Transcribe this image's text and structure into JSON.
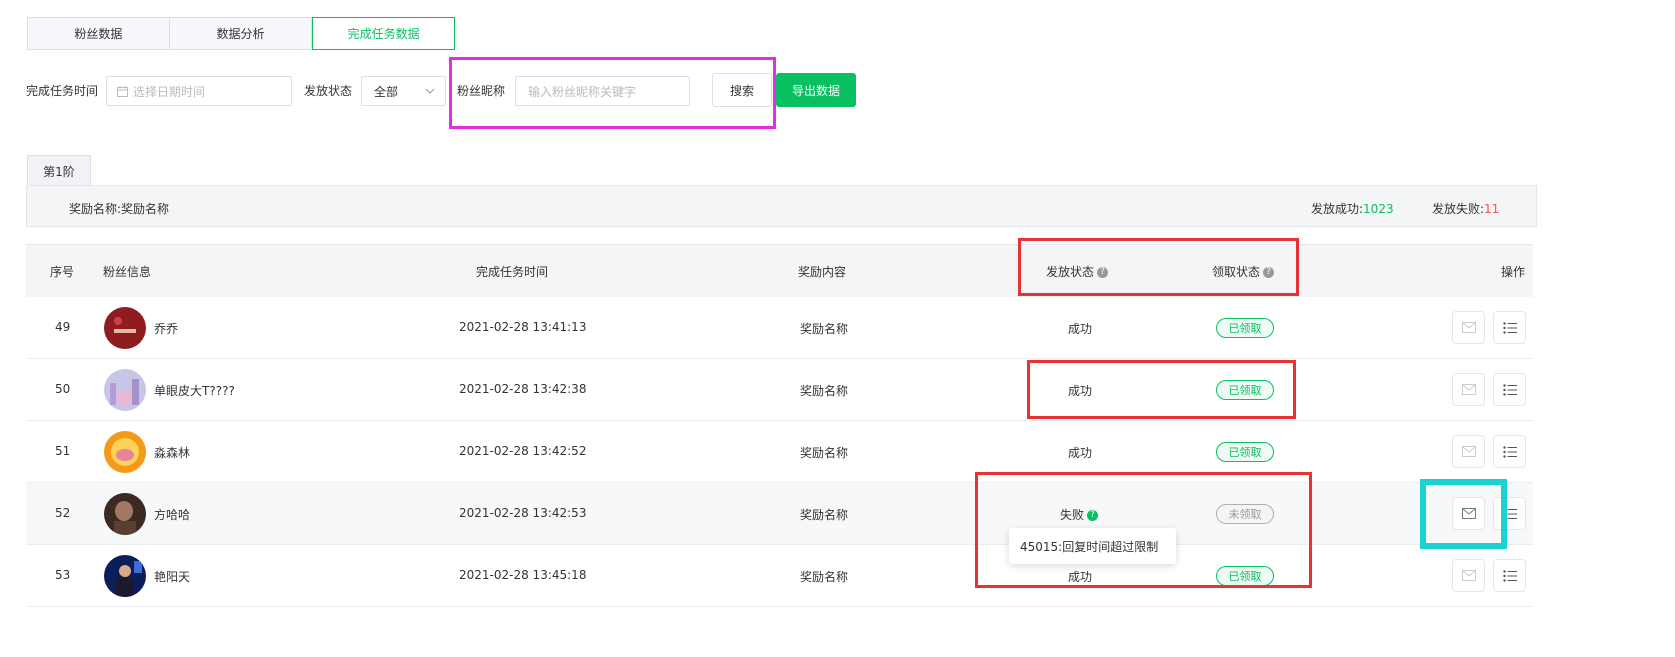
{
  "tabs": [
    "粉丝数据",
    "数据分析",
    "完成任务数据"
  ],
  "filters": {
    "time_label": "完成任务时间",
    "time_placeholder": "选择日期时间",
    "status_label": "发放状态",
    "status_value": "全部",
    "nick_label": "粉丝昵称",
    "nick_placeholder": "输入粉丝昵称关键字",
    "search_button": "搜索",
    "export_button": "导出数据"
  },
  "stage_tab": "第1阶",
  "reward_bar": {
    "name": "奖励名称:奖励名称",
    "success_label": "发放成功:",
    "success_count": "1023",
    "fail_label": "发放失败:",
    "fail_count": "11"
  },
  "table": {
    "headers": {
      "no": "序号",
      "fan": "粉丝信息",
      "time": "完成任务时间",
      "reward": "奖励内容",
      "send_status": "发放状态",
      "claim_status": "领取状态",
      "ops": "操作"
    },
    "rows": [
      {
        "no": "49",
        "name": "乔乔",
        "time": "2021-02-28 13:41:13",
        "reward": "奖励名称",
        "send": "成功",
        "claim": "已领取"
      },
      {
        "no": "50",
        "name": "单眼皮大T????",
        "time": "2021-02-28 13:42:38",
        "reward": "奖励名称",
        "send": "成功",
        "claim": "已领取"
      },
      {
        "no": "51",
        "name": "淼森林",
        "time": "2021-02-28 13:42:52",
        "reward": "奖励名称",
        "send": "成功",
        "claim": "已领取"
      },
      {
        "no": "52",
        "name": "方哈哈",
        "time": "2021-02-28 13:42:53",
        "reward": "奖励名称",
        "send": "失败",
        "claim": "未领取"
      },
      {
        "no": "53",
        "name": "艳阳天",
        "time": "2021-02-28 13:45:18",
        "reward": "奖励名称",
        "send": "成功",
        "claim": "已领取"
      }
    ]
  },
  "tooltip": "45015:回复时间超过限制",
  "colors": {
    "brand_green": "#07c160",
    "fail_red": "#fa5151",
    "annotation_red": "#e63434",
    "annotation_magenta": "#e32de3",
    "annotation_cyan": "#1ad2d2"
  },
  "icons": [
    "calendar-icon",
    "chevron-down-icon",
    "help-icon",
    "mail-icon",
    "list-icon"
  ]
}
